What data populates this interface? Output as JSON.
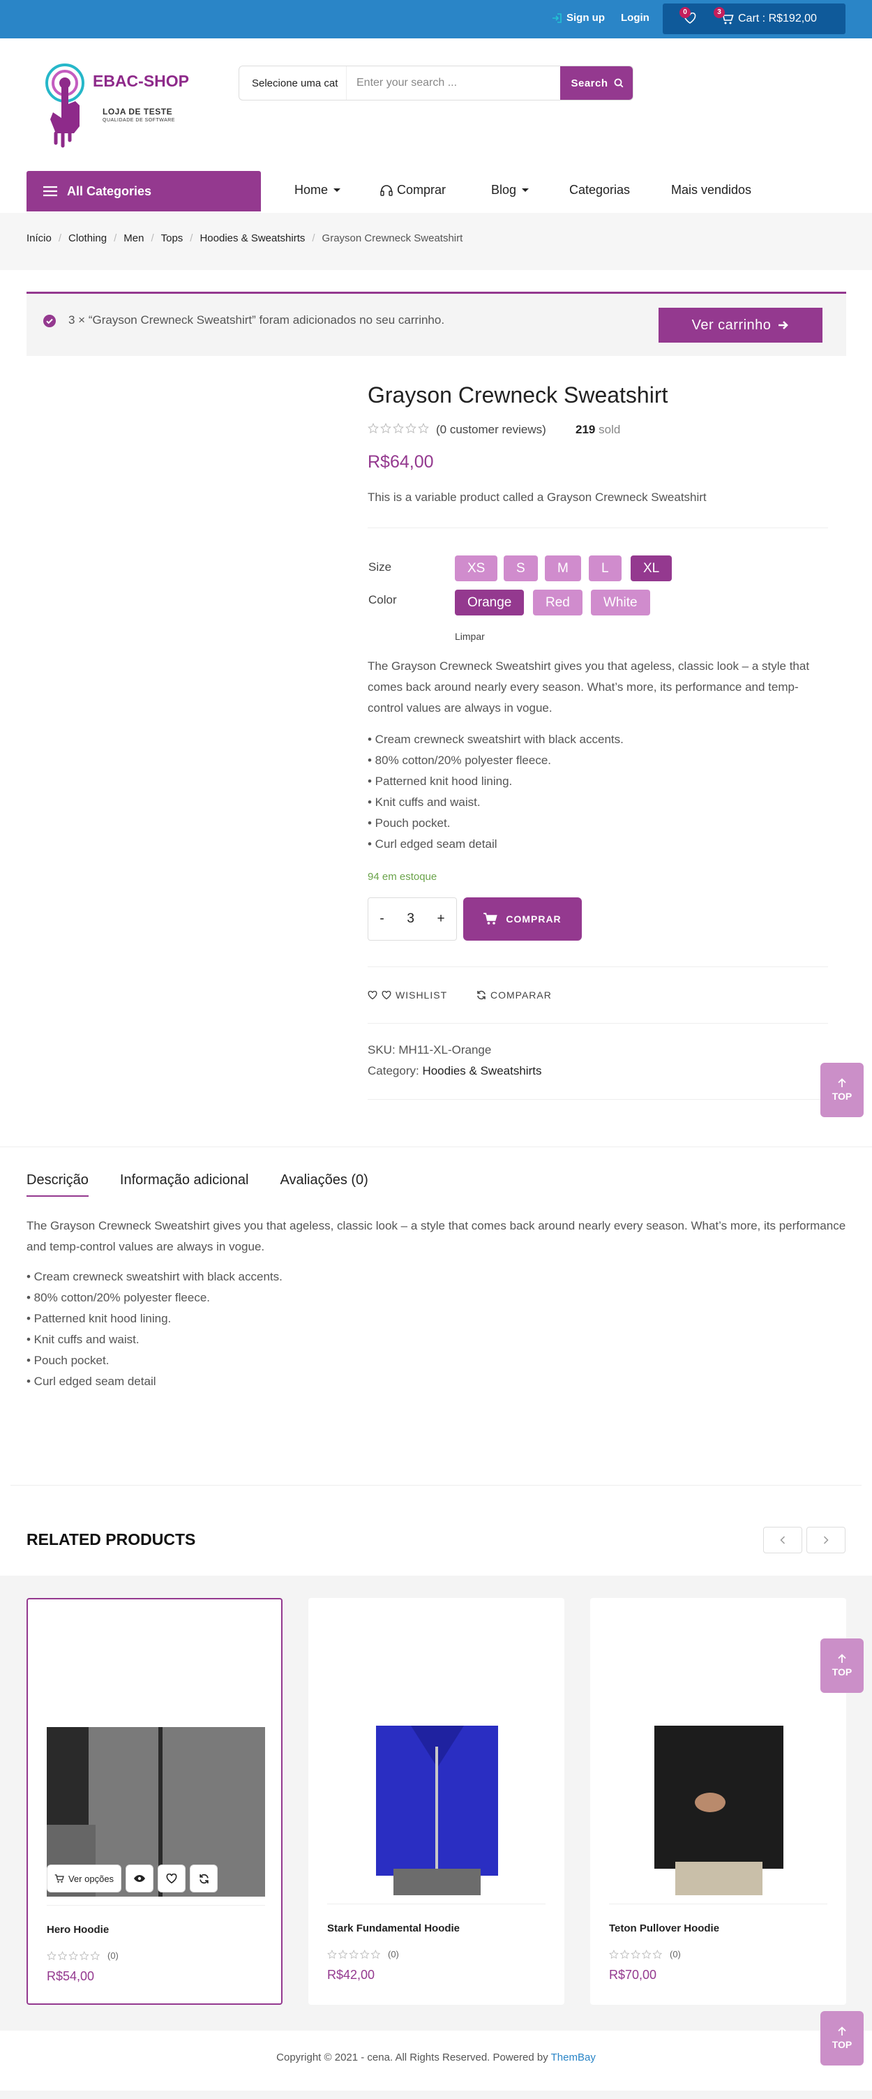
{
  "topbar": {
    "signup": "Sign up",
    "login": "Login",
    "wishlist_count": "0",
    "cart_count": "3",
    "cart_label": "Cart : R$192,00"
  },
  "logo": {
    "title": "EBAC-SHOP",
    "subtitle": "LOJA DE TESTE",
    "tagline": "QUALIDADE DE SOFTWARE"
  },
  "search": {
    "category": "Selecione uma cat",
    "placeholder": "Enter your search ...",
    "button": "Search"
  },
  "nav": {
    "all_categories": "All Categories",
    "items": [
      "Home",
      "Comprar",
      "Blog",
      "Categorias",
      "Mais vendidos"
    ]
  },
  "breadcrumb": [
    "Início",
    "Clothing",
    "Men",
    "Tops",
    "Hoodies & Sweatshirts",
    "Grayson Crewneck Sweatshirt"
  ],
  "notice": {
    "text": "3 × “Grayson Crewneck Sweatshirt” foram adicionados no seu carrinho.",
    "button": "Ver carrinho"
  },
  "product": {
    "title": "Grayson Crewneck Sweatshirt",
    "rating": 0,
    "reviews": "(0 customer reviews)",
    "sold_count": "219",
    "sold_label": "sold",
    "price": "R$64,00",
    "short_desc": "This is a variable product called a Grayson Crewneck Sweatshirt",
    "size_label": "Size",
    "sizes": [
      "XS",
      "S",
      "M",
      "L",
      "XL"
    ],
    "selected_size": "XL",
    "color_label": "Color",
    "colors": [
      "Orange",
      "Red",
      "White"
    ],
    "selected_color": "Orange",
    "clear": "Limpar",
    "description": "The Grayson Crewneck Sweatshirt gives you that ageless, classic look – a style that comes back around nearly every season. What’s more, its performance and temp-control values are always in vogue.",
    "bullets": [
      "• Cream crewneck sweatshirt with black accents.",
      "• 80% cotton/20% polyester fleece.",
      "• Patterned knit hood lining.",
      "• Knit cuffs and waist.",
      "• Pouch pocket.",
      "• Curl edged seam detail"
    ],
    "stock": "94 em estoque",
    "qty_minus": "-",
    "qty": "3",
    "qty_plus": "+",
    "buy": "COMPRAR",
    "wishlist": "WISHLIST",
    "compare": "COMPARAR",
    "sku": "SKU: MH11-XL-Orange",
    "category_label": "Category:",
    "category": "Hoodies & Sweatshirts"
  },
  "tabs": {
    "items": [
      "Descrição",
      "Informação adicional",
      "Avaliações (0)"
    ],
    "active": "Descrição",
    "description": "The Grayson Crewneck Sweatshirt gives you that ageless, classic look – a style that comes back around nearly every season. What’s more, its performance and temp-control values are always in vogue."
  },
  "related": {
    "title": "RELATED PRODUCTS",
    "products": [
      {
        "name": "Hero Hoodie",
        "reviews": "(0)",
        "price": "R$54,00",
        "rating": 0,
        "color": "#6e6e6e",
        "options": "Ver opções"
      },
      {
        "name": "Stark Fundamental Hoodie",
        "reviews": "(0)",
        "price": "R$42,00",
        "rating": 0,
        "color": "#2a2ec2"
      },
      {
        "name": "Teton Pullover Hoodie",
        "reviews": "(0)",
        "price": "R$70,00",
        "rating": 0,
        "color": "#1c1c1c"
      }
    ]
  },
  "top_button": "TOP",
  "footer": {
    "text": "Copyright © 2021 - cena. All Rights Reserved. Powered by",
    "link": "ThemBay"
  },
  "colors": {
    "accent": "#94398f",
    "swatch": "#d08ccd",
    "topbar": "#2a85c7",
    "cart_bg": "#0f5a9a",
    "badge": "#c41f5c",
    "stock": "#6aa34a"
  }
}
